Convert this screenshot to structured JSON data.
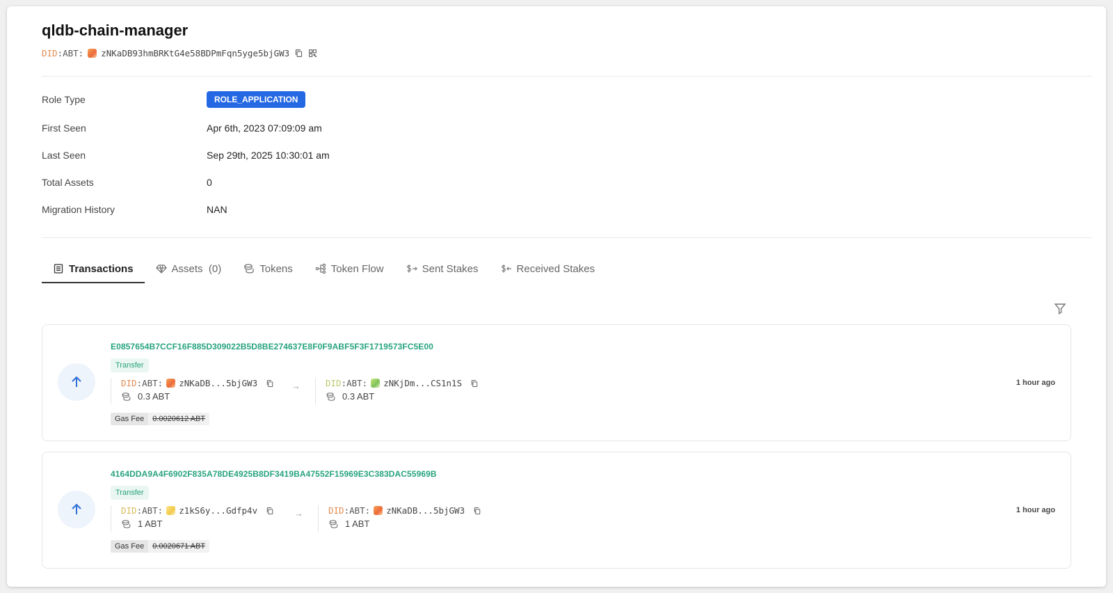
{
  "header": {
    "title": "qldb-chain-manager",
    "did_prefix_1": "DID",
    "did_prefix_2": ":ABT:",
    "did_address": "zNKaDB93hmBRKtG4e58BDPmFqn5yge5bjGW3"
  },
  "details": [
    {
      "label": "Role Type",
      "value": "ROLE_APPLICATION"
    },
    {
      "label": "First Seen",
      "value": "Apr 6th, 2023 07:09:09 am"
    },
    {
      "label": "Last Seen",
      "value": "Sep 29th, 2025 10:30:01 am"
    },
    {
      "label": "Total Assets",
      "value": "0"
    },
    {
      "label": "Migration History",
      "value": "NAN"
    }
  ],
  "tabs": [
    {
      "label": "Transactions",
      "icon": "list-icon"
    },
    {
      "label": "Assets  (0)",
      "icon": "diamond-icon"
    },
    {
      "label": "Tokens",
      "icon": "coins-icon"
    },
    {
      "label": "Token Flow",
      "icon": "flow-icon"
    },
    {
      "label": "Sent Stakes",
      "icon": "sent-stake-icon"
    },
    {
      "label": "Received Stakes",
      "icon": "received-stake-icon"
    }
  ],
  "transactions": [
    {
      "hash": "E0857654B7CCF16F885D309022B5D8BE274637E8F0F9ABF5F3F1719573FC5E00",
      "type": "Transfer",
      "from": {
        "did_prefix_1": "DID",
        "did_prefix_2": ":ABT:",
        "address": "zNKaDB...5bjGW3",
        "amount": "0.3 ABT"
      },
      "to": {
        "did_prefix_1": "DID",
        "did_prefix_2": ":ABT:",
        "address": "zNKjDm...CS1n1S",
        "amount": "0.3 ABT"
      },
      "gas_label": "Gas Fee",
      "gas_value": "0.0020612 ABT",
      "time": "1 hour ago"
    },
    {
      "hash": "4164DDA9A4F6902F835A78DE4925B8DF3419BA47552F15969E3C383DAC55969B",
      "type": "Transfer",
      "from": {
        "did_prefix_1": "DID",
        "did_prefix_2": ":ABT:",
        "address": "z1kS6y...Gdfp4v",
        "amount": "1 ABT"
      },
      "to": {
        "did_prefix_1": "DID",
        "did_prefix_2": ":ABT:",
        "address": "zNKaDB...5bjGW3",
        "amount": "1 ABT"
      },
      "gas_label": "Gas Fee",
      "gas_value": "0.0020671 ABT",
      "time": "1 hour ago"
    }
  ]
}
